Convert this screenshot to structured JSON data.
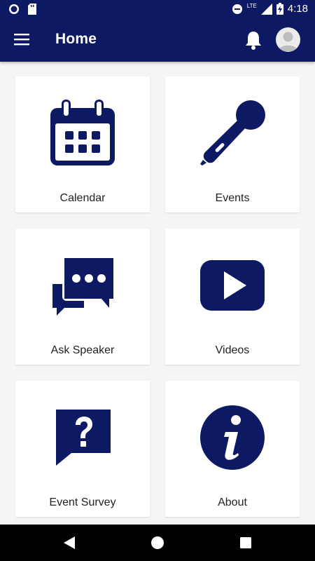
{
  "status_bar": {
    "time": "4:18",
    "network": "LTE",
    "icons": [
      "circle-notification-icon",
      "sd-card-icon",
      "do-not-disturb-icon",
      "signal-icon",
      "battery-charging-icon"
    ]
  },
  "header": {
    "title": "Home",
    "icons": [
      "hamburger-menu-icon",
      "notification-bell-icon",
      "user-avatar-icon"
    ]
  },
  "tiles": [
    {
      "label": "Calendar",
      "icon": "calendar-icon"
    },
    {
      "label": "Events",
      "icon": "microphone-icon"
    },
    {
      "label": "Ask Speaker",
      "icon": "chat-bubbles-icon"
    },
    {
      "label": "Videos",
      "icon": "video-play-icon"
    },
    {
      "label": "Event Survey",
      "icon": "question-bubble-icon"
    },
    {
      "label": "About",
      "icon": "info-icon"
    }
  ],
  "navigation": {
    "icons": [
      "back-icon",
      "home-icon",
      "recents-icon"
    ]
  },
  "colors": {
    "primary": "#0d1a63",
    "background": "#f5f5f5",
    "tile": "#ffffff",
    "text": "#222222"
  }
}
